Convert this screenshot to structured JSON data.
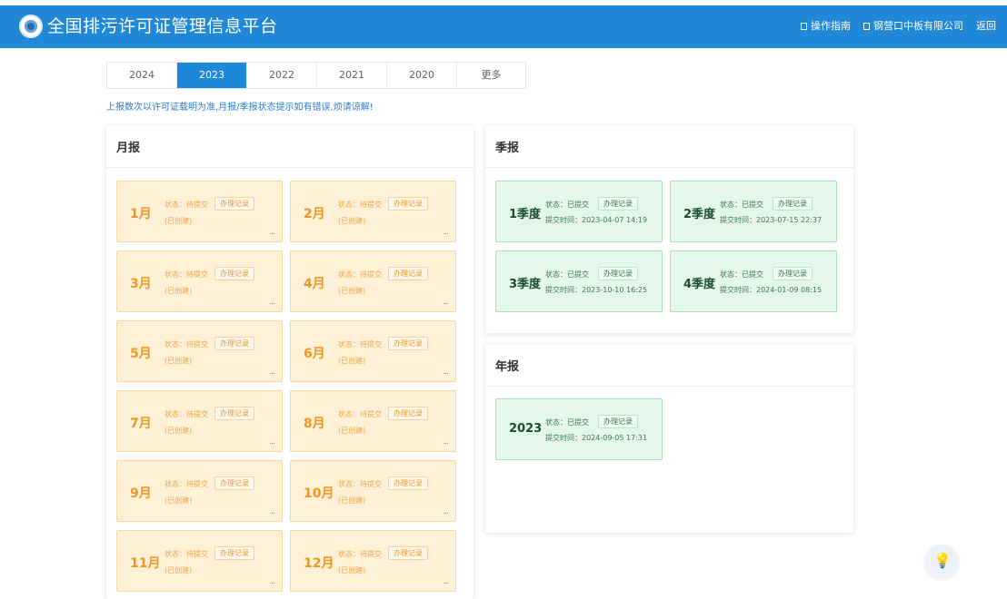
{
  "header": {
    "title": "全国排污许可证管理信息平台",
    "links": [
      {
        "label": "操作指南"
      },
      {
        "label": "钢营口中板有限公司"
      },
      {
        "label": "返回"
      }
    ],
    "bg_color": "#2188d8"
  },
  "year_tabs": [
    "2024",
    "2023",
    "2022",
    "2021",
    "2020",
    "更多"
  ],
  "active_year": "2023",
  "notice": "上报数次以许可证载明为准,月报/季报状态提示如有错误,烦请谅解!",
  "monthly": {
    "title": "月报",
    "cards": [
      {
        "label": "1月",
        "status": "状态：待提交",
        "created": "(已创建)",
        "record": "办理记录",
        "more": "..."
      },
      {
        "label": "2月",
        "status": "状态：待提交",
        "created": "(已创建)",
        "record": "办理记录",
        "more": "..."
      },
      {
        "label": "3月",
        "status": "状态：待提交",
        "created": "(已创建)",
        "record": "办理记录",
        "more": "..."
      },
      {
        "label": "4月",
        "status": "状态：待提交",
        "created": "(已创建)",
        "record": "办理记录",
        "more": "..."
      },
      {
        "label": "5月",
        "status": "状态：待提交",
        "created": "(已创建)",
        "record": "办理记录",
        "more": "..."
      },
      {
        "label": "6月",
        "status": "状态：待提交",
        "created": "(已创建)",
        "record": "办理记录",
        "more": "..."
      },
      {
        "label": "7月",
        "status": "状态：待提交",
        "created": "(已创建)",
        "record": "办理记录",
        "more": "..."
      },
      {
        "label": "8月",
        "status": "状态：待提交",
        "created": "(已创建)",
        "record": "办理记录",
        "more": "..."
      },
      {
        "label": "9月",
        "status": "状态：待提交",
        "created": "(已创建)",
        "record": "办理记录",
        "more": "..."
      },
      {
        "label": "10月",
        "status": "状态：待提交",
        "created": "(已创建)",
        "record": "办理记录",
        "more": "..."
      },
      {
        "label": "11月",
        "status": "状态：待提交",
        "created": "(已创建)",
        "record": "办理记录",
        "more": "..."
      },
      {
        "label": "12月",
        "status": "状态：待提交",
        "created": "(已创建)",
        "record": "办理记录",
        "more": "..."
      }
    ]
  },
  "quarterly": {
    "title": "季报",
    "cards": [
      {
        "label": "1季度",
        "status": "状态：已提交",
        "record": "办理记录",
        "time": "提交时间：2023-04-07 14:19"
      },
      {
        "label": "2季度",
        "status": "状态：已提交",
        "record": "办理记录",
        "time": "提交时间：2023-07-15 22:37"
      },
      {
        "label": "3季度",
        "status": "状态：已提交",
        "record": "办理记录",
        "time": "提交时间：2023-10-10 16:25"
      },
      {
        "label": "4季度",
        "status": "状态：已提交",
        "record": "办理记录",
        "time": "提交时间：2024-01-09 08:15"
      }
    ]
  },
  "annual": {
    "title": "年报",
    "card": {
      "label": "2023",
      "status": "状态：已提交",
      "record": "办理记录",
      "time": "提交时间：2024-09-05 17:31"
    }
  }
}
